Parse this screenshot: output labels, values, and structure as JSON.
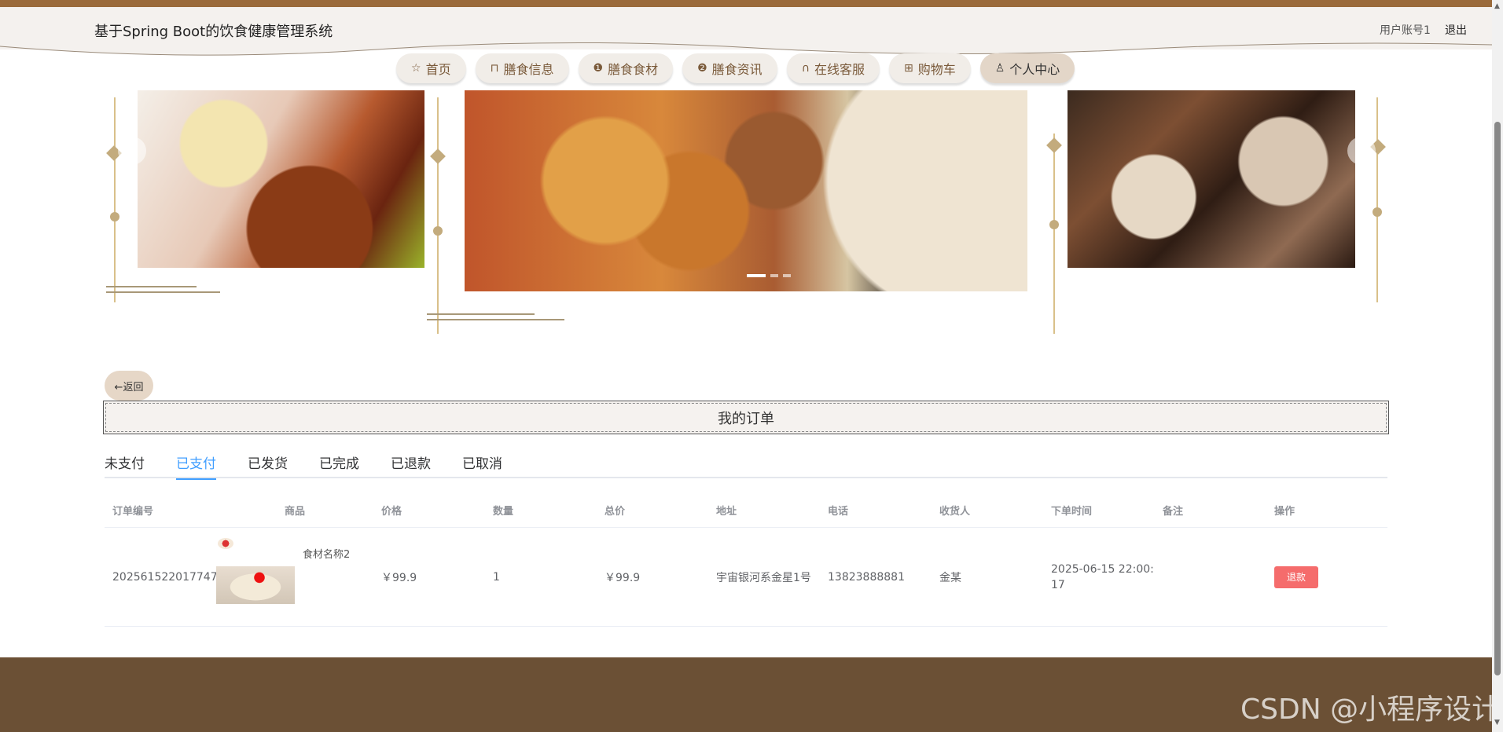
{
  "header": {
    "title": "基于Spring Boot的饮食健康管理系统",
    "user_account": "用户账号1",
    "logout": "退出"
  },
  "nav": [
    {
      "label": "首页",
      "icon": "star-icon",
      "glyph": "☆"
    },
    {
      "label": "膳食信息",
      "icon": "bag-icon",
      "glyph": "⊓"
    },
    {
      "label": "膳食食材",
      "icon": "info-icon",
      "glyph": "❶"
    },
    {
      "label": "膳食资讯",
      "icon": "question-icon",
      "glyph": "❷"
    },
    {
      "label": "在线客服",
      "icon": "headset-icon",
      "glyph": "∩"
    },
    {
      "label": "购物车",
      "icon": "cart-icon",
      "glyph": "⊞"
    },
    {
      "label": "个人中心",
      "icon": "user-icon",
      "glyph": "♙"
    }
  ],
  "back": "←返回",
  "orders": {
    "title": "我的订单",
    "tabs": [
      "未支付",
      "已支付",
      "已发货",
      "已完成",
      "已退款",
      "已取消"
    ],
    "active_tab": "已支付",
    "columns": [
      "订单编号",
      "商品",
      "价格",
      "数量",
      "总价",
      "地址",
      "电话",
      "收货人",
      "下单时间",
      "备注",
      "操作"
    ],
    "rows": [
      {
        "order_no": "202561522017747",
        "goods_name": "食材名称2",
        "price": "￥99.9",
        "quantity": "1",
        "total": "￥99.9",
        "address": "宇宙银河系金星1号",
        "phone": "13823888881",
        "receiver": "金某",
        "time": "2025-06-15 22:00:17",
        "remark": "",
        "action": "退款"
      }
    ]
  },
  "watermark": "CSDN @小程序设计",
  "colors": {
    "brand_brown": "#9a6a3a",
    "footer": "#6b5035",
    "tab_active": "#409eff",
    "danger": "#f56c6c"
  }
}
